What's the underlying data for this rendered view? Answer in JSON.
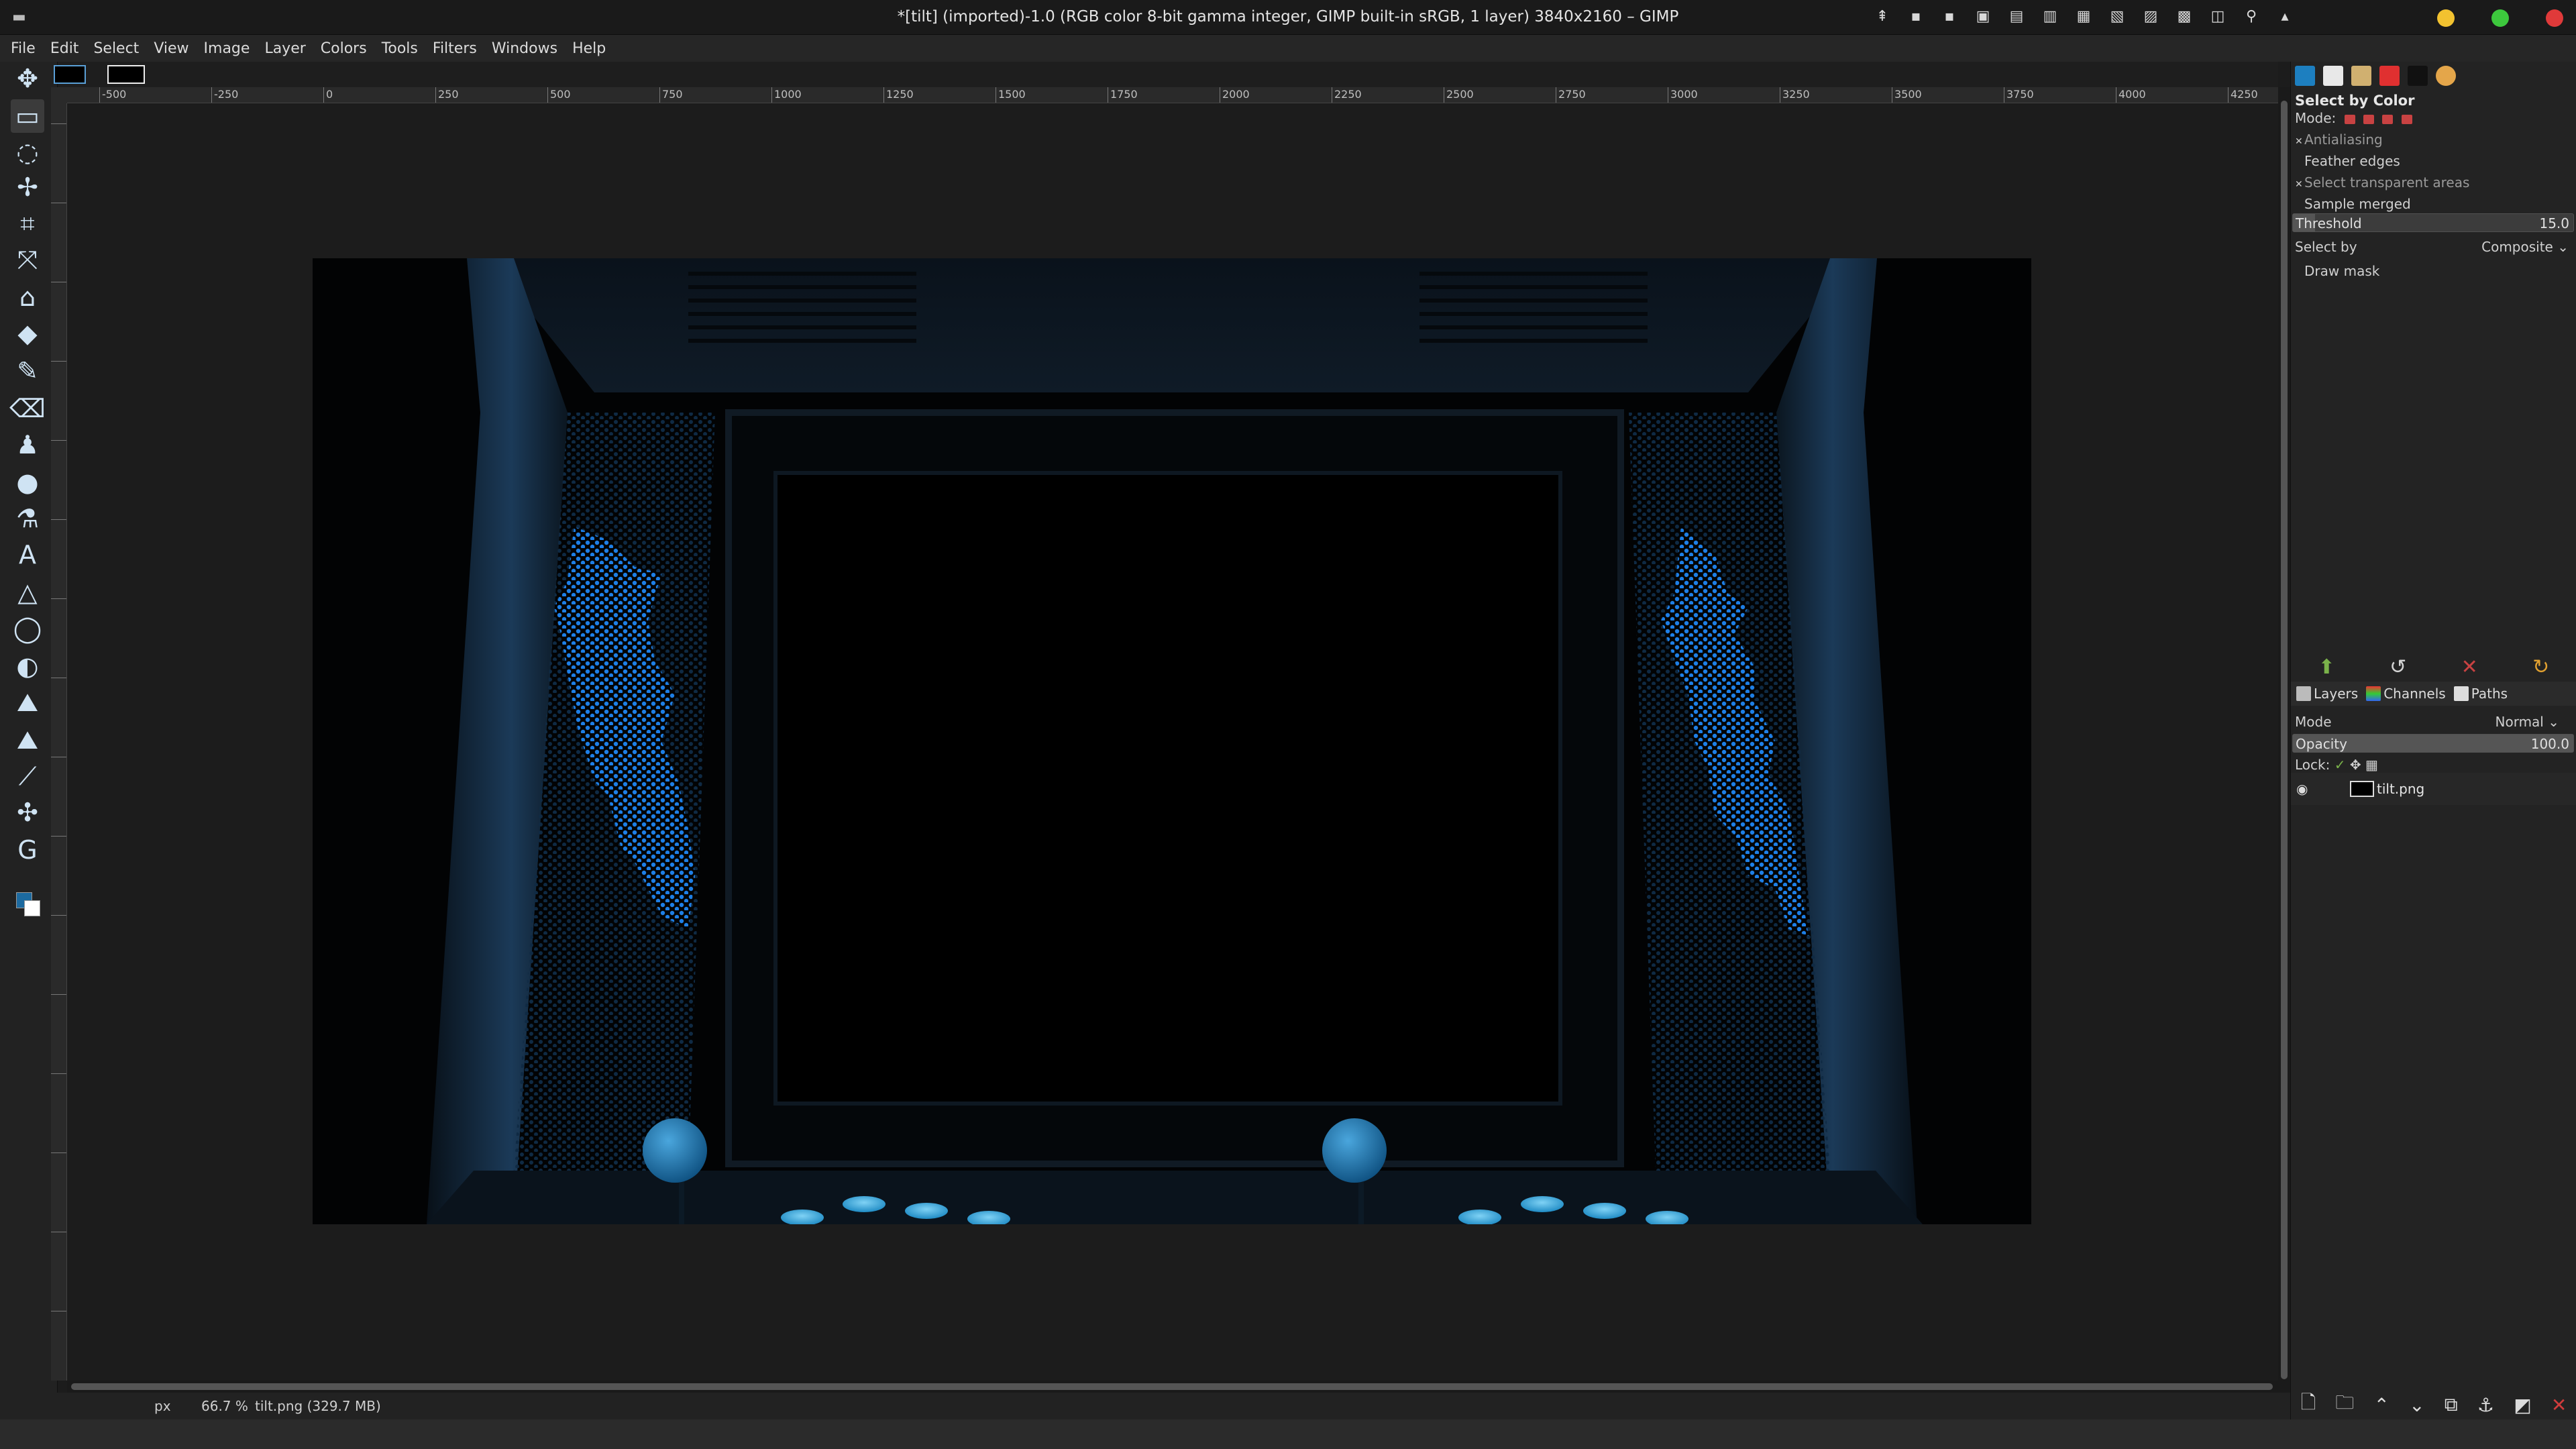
{
  "window": {
    "title": "*[tilt] (imported)-1.0 (RGB color 8-bit gamma integer, GIMP built-in sRGB, 1 layer) 3840x2160 – GIMP"
  },
  "menu": [
    "File",
    "Edit",
    "Select",
    "View",
    "Image",
    "Layer",
    "Colors",
    "Tools",
    "Filters",
    "Windows",
    "Help"
  ],
  "ruler": {
    "labels": [
      "-500",
      "-250",
      "0",
      "250",
      "500",
      "750",
      "1000",
      "1250",
      "1500",
      "1750",
      "2000",
      "2250",
      "2500",
      "2750",
      "3000",
      "3250",
      "3500",
      "3750",
      "4000",
      "4250"
    ]
  },
  "statusbar": {
    "unit": "px",
    "zoom": "66.7 %",
    "file_info": "tilt.png (329.7 MB)"
  },
  "tool_options": {
    "title": "Select by Color",
    "mode_label": "Mode:",
    "options": [
      {
        "label": "Antialiasing",
        "checked": true
      },
      {
        "label": "Feather edges",
        "checked": false
      },
      {
        "label": "Select transparent areas",
        "checked": true
      },
      {
        "label": "Sample merged",
        "checked": false
      }
    ],
    "threshold_label": "Threshold",
    "threshold_value": "15.0",
    "select_by_label": "Select by",
    "select_by_value": "Composite",
    "draw_mask_label": "Draw mask"
  },
  "layers_panel": {
    "tabs": [
      "Layers",
      "Channels",
      "Paths"
    ],
    "mode_label": "Mode",
    "mode_value": "Normal",
    "opacity_label": "Opacity",
    "opacity_value": "100.0",
    "lock_label": "Lock:",
    "layers": [
      {
        "name": "tilt.png",
        "visible": true
      }
    ]
  },
  "colors": {
    "accent": "#1c6aa0",
    "neon": "#1e7fe6"
  }
}
